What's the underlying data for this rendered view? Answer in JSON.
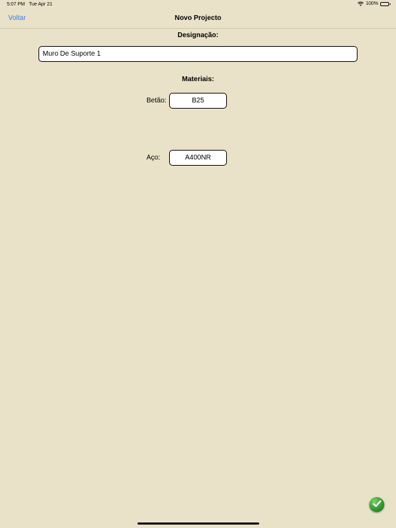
{
  "status_bar": {
    "time": "5:07 PM",
    "date": "Tue Apr 21",
    "battery": "100%"
  },
  "nav": {
    "back_label": "Voltar",
    "title": "Novo Projecto"
  },
  "form": {
    "designation_label": "Designação:",
    "designation_value": "Muro De Suporte 1",
    "materials_label": "Materiais:",
    "concrete_label": "Betão:",
    "concrete_value": "B25",
    "steel_label": "Aço:",
    "steel_value": "A400NR"
  },
  "icons": {
    "confirm": "checkmark-icon",
    "wifi": "wifi-icon",
    "battery": "battery-icon"
  },
  "colors": {
    "background": "#e9e1c8",
    "accent": "#2f7df6",
    "confirm": "#2f9a2b"
  }
}
